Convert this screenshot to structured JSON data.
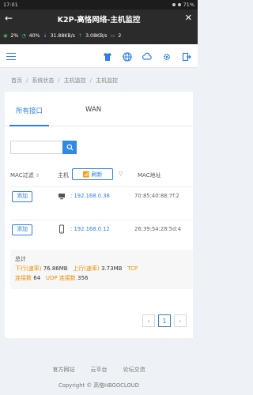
{
  "status_bar": {
    "time": "17:01",
    "battery": "71%"
  },
  "app": {
    "title": "K2P-高恪网络-主机监控"
  },
  "info": {
    "cpu": "2%",
    "mem": "40%",
    "down": "31.88KB/s",
    "up": "3.08KB/s",
    "clients": "2"
  },
  "breadcrumb": [
    "首页",
    "系统状态",
    "主机监控",
    "主机监控"
  ],
  "tabs": [
    "所有接口",
    "WAN"
  ],
  "search": {
    "placeholder": ""
  },
  "table": {
    "col_mac_filter": "MAC过滤",
    "col_host": "主机",
    "refresh_label": "刷新",
    "col_mac_addr": "MAC地址",
    "rows": [
      {
        "action": "添加",
        "device": "desktop-icon",
        "ip": ": 192.168.0.38",
        "mac": "70:85:40:88:7f:2"
      },
      {
        "action": "添加",
        "device": "phone-icon",
        "ip": ": 192.168.0.12",
        "mac": "26:39:54:28:5d:4"
      }
    ]
  },
  "summary": {
    "label": "总计",
    "down_label": "下行(速率)",
    "down_value": "76.86MB",
    "up_label": "上行(速率)",
    "up_value": "3.73MB",
    "tcp_label": "TCP",
    "tcp_conn_label": "连接数",
    "tcp_conn_value": "64",
    "udp_label": "UDP 连接数",
    "udp_value": "356"
  },
  "pagination": {
    "current": "1",
    "prev": "‹",
    "next": "›"
  },
  "footer": {
    "links": [
      "官方网站",
      "云平台",
      "论坛交流"
    ],
    "copyright": "Copyright © 高恪HBGOCLOUD"
  },
  "colors": {
    "accent": "#2f7ee6",
    "orange": "#f08c00",
    "header": "#2b2b2b"
  }
}
